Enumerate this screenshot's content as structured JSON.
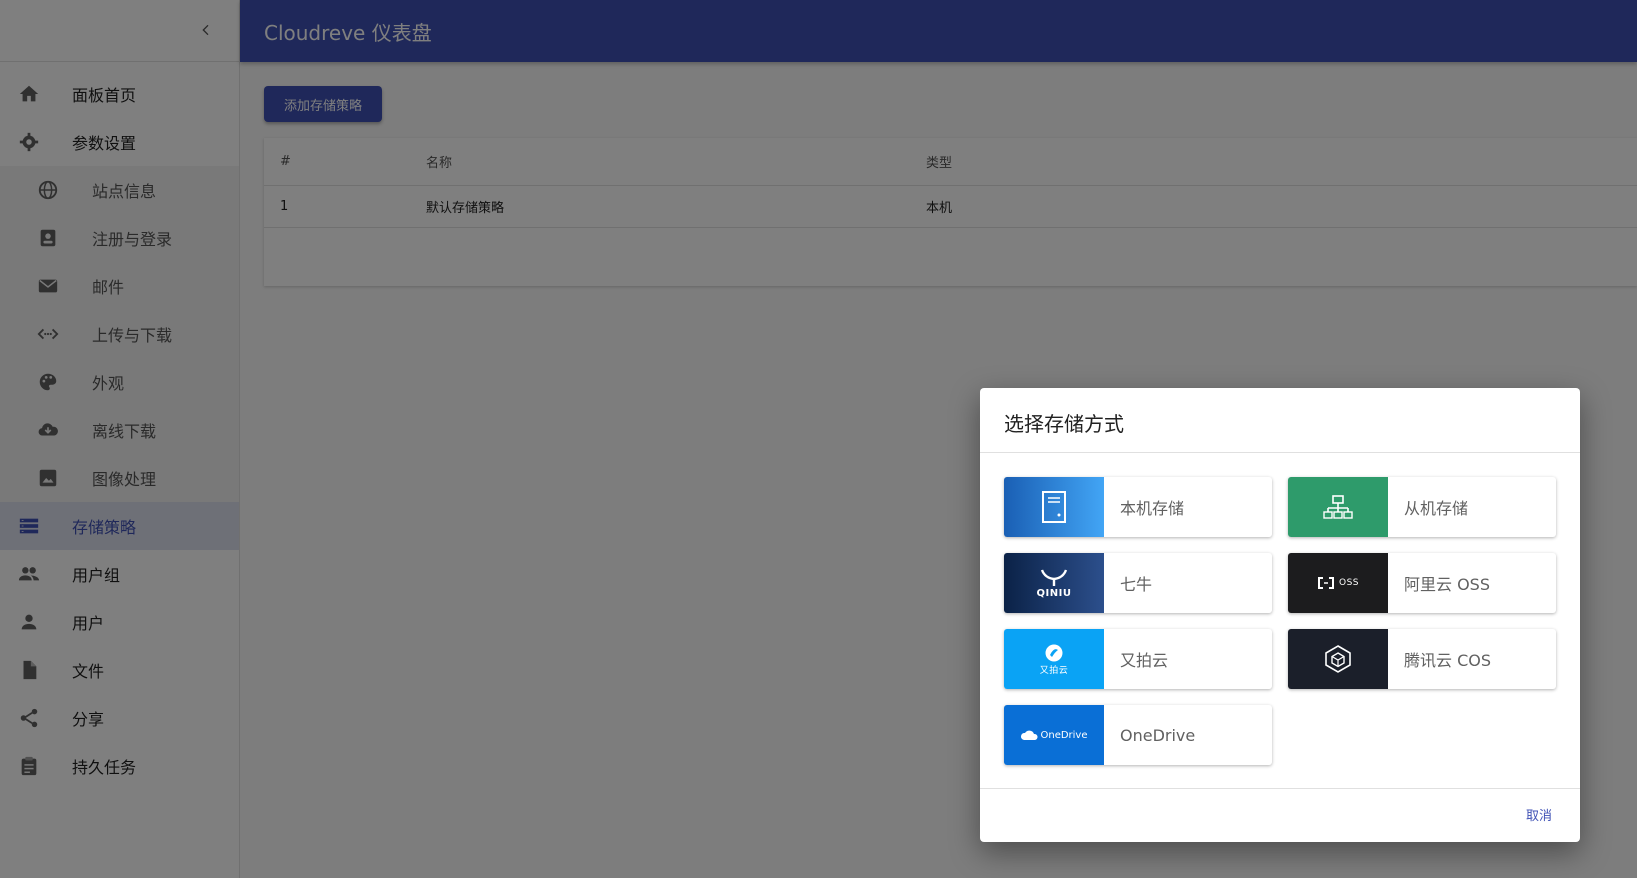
{
  "appbar": {
    "title": "Cloudreve 仪表盘"
  },
  "sidebar": {
    "items": [
      {
        "label": "面板首页",
        "icon": "home-icon"
      },
      {
        "label": "参数设置",
        "icon": "gear-icon"
      },
      {
        "label": "站点信息",
        "icon": "globe-icon"
      },
      {
        "label": "注册与登录",
        "icon": "contact-card-icon"
      },
      {
        "label": "邮件",
        "icon": "mail-icon"
      },
      {
        "label": "上传与下载",
        "icon": "code-transfer-icon"
      },
      {
        "label": "外观",
        "icon": "palette-icon"
      },
      {
        "label": "离线下载",
        "icon": "cloud-download-icon"
      },
      {
        "label": "图像处理",
        "icon": "image-icon"
      },
      {
        "label": "存储策略",
        "icon": "storage-icon"
      },
      {
        "label": "用户组",
        "icon": "group-icon"
      },
      {
        "label": "用户",
        "icon": "person-icon"
      },
      {
        "label": "文件",
        "icon": "file-icon"
      },
      {
        "label": "分享",
        "icon": "share-icon"
      },
      {
        "label": "持久任务",
        "icon": "clipboard-icon"
      }
    ]
  },
  "main": {
    "add_button": "添加存储策略",
    "table": {
      "headers": [
        "#",
        "名称",
        "类型"
      ],
      "rows": [
        [
          "1",
          "默认存储策略",
          "本机"
        ]
      ]
    }
  },
  "dialog": {
    "title": "选择存储方式",
    "options": [
      {
        "name": "本机存储",
        "logo_text": "",
        "color": "#1e6fc9"
      },
      {
        "name": "从机存储",
        "logo_text": "",
        "color": "#2e9b6b"
      },
      {
        "name": "七牛",
        "logo_text": "QINIU",
        "color": "#0f2d5a"
      },
      {
        "name": "阿里云 OSS",
        "logo_text": "OSS",
        "color": "#1c1c1e"
      },
      {
        "name": "又拍云",
        "logo_text": "又拍云",
        "color": "#0aa3f5"
      },
      {
        "name": "腾讯云 COS",
        "logo_text": "",
        "color": "#1b1f2a"
      },
      {
        "name": "OneDrive",
        "logo_text": "OneDrive",
        "color": "#0a6fd6"
      }
    ],
    "cancel": "取消"
  },
  "colors": {
    "primary": "#3f51b5",
    "overlay": "rgba(0,0,0,0.5)"
  }
}
